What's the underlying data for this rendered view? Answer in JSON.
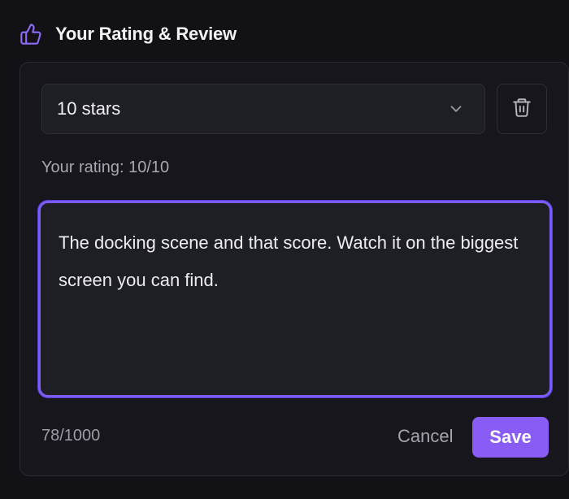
{
  "header": {
    "icon": "thumbs-up-icon",
    "title": "Your Rating & Review"
  },
  "rating_select": {
    "selected": "10 stars",
    "icon": "chevron-down-icon"
  },
  "delete_button": {
    "icon": "trash-icon"
  },
  "rating_summary": "Your rating: 10/10",
  "rating_value": 10,
  "rating_max": 10,
  "review": {
    "value": "The docking scene and that score. Watch it on the biggest screen you can find."
  },
  "char_counter": "78/1000",
  "actions": {
    "cancel_label": "Cancel",
    "save_label": "Save"
  },
  "colors": {
    "accent": "#8a5cf6",
    "focus_border": "#7b5cf6",
    "background": "#111116",
    "card": "#16161c"
  }
}
